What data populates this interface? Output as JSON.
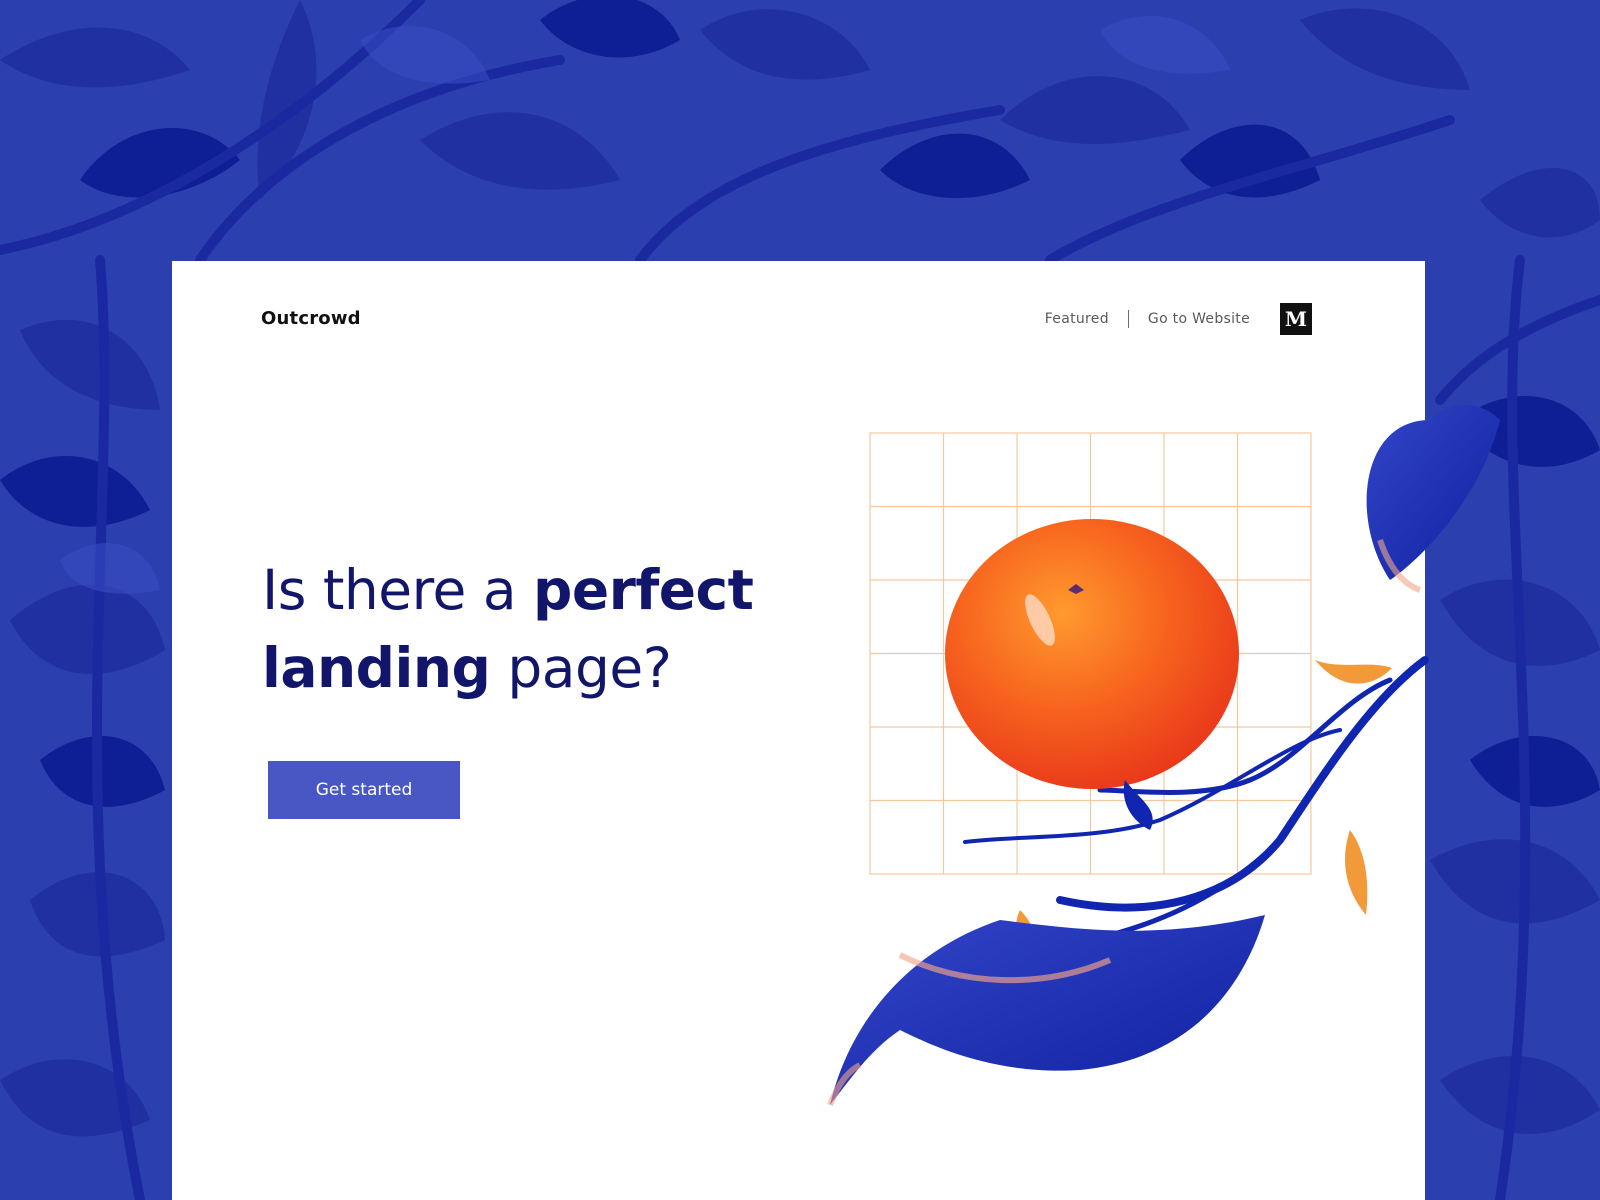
{
  "brand": {
    "name": "Outcrowd"
  },
  "nav": {
    "featured_label": "Featured",
    "website_label": "Go to Website",
    "medium_glyph": "M",
    "medium_icon": "medium-logo-icon"
  },
  "hero": {
    "headline_light_1": "Is there a ",
    "headline_bold_1": "perfect",
    "headline_bold_2": "landing",
    "headline_light_2": " page?",
    "cta_label": "Get started"
  },
  "illustration": {
    "subject": "orange-on-branch",
    "colors": {
      "background": "#2b3fae",
      "leaf_dark": "#0e1fa0",
      "grid": "#f6c79f",
      "fruit": "#f2501c",
      "accent": "#f29a3a"
    }
  },
  "colors": {
    "headline": "#12166b",
    "button": "#4957c4",
    "card": "#ffffff"
  }
}
